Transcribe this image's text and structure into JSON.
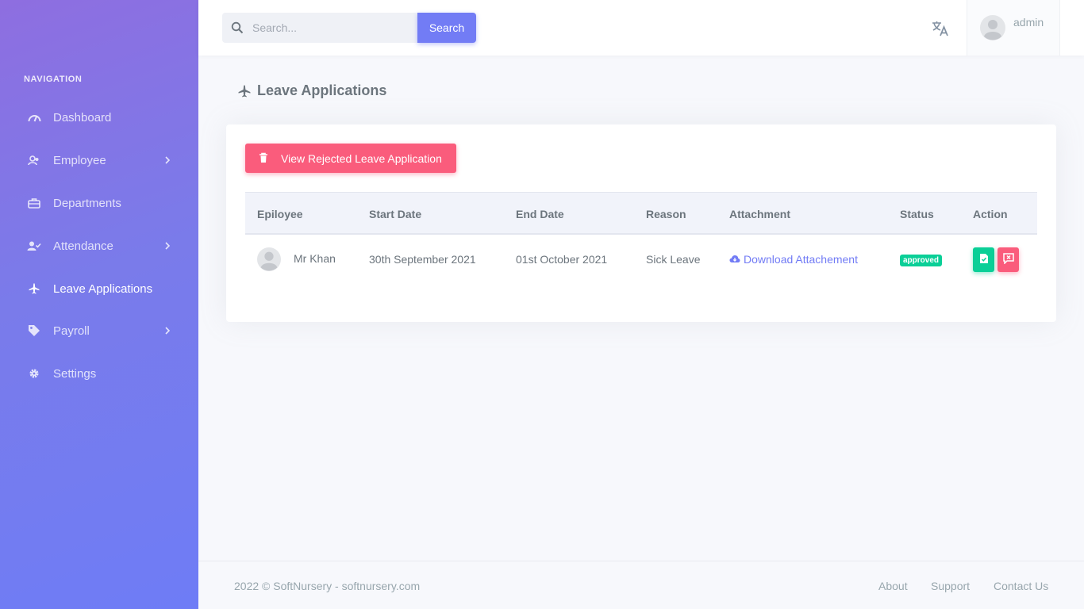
{
  "sidebar": {
    "heading": "NAVIGATION",
    "items": [
      {
        "label": "Dashboard",
        "icon": "gauge-icon"
      },
      {
        "label": "Employee",
        "icon": "users-icon"
      },
      {
        "label": "Departments",
        "icon": "briefcase-icon"
      },
      {
        "label": "Attendance",
        "icon": "user-check-icon"
      },
      {
        "label": "Leave Applications",
        "icon": "airplane-icon"
      },
      {
        "label": "Payroll",
        "icon": "tag-icon"
      },
      {
        "label": "Settings",
        "icon": "gear-icon"
      }
    ]
  },
  "topbar": {
    "search_placeholder": "Search...",
    "search_value": "",
    "search_button": "Search",
    "user_name": "admin"
  },
  "page": {
    "title": "Leave Applications",
    "rejected_button": "View Rejected Leave Application"
  },
  "table": {
    "headers": [
      "Epiloyee",
      "Start Date",
      "End Date",
      "Reason",
      "Attachment",
      "Status",
      "Action"
    ],
    "rows": [
      {
        "employee": "Mr Khan",
        "start_date": "30th September 2021",
        "end_date": "01st October 2021",
        "reason": "Sick Leave",
        "attachment": "Download Attachement",
        "status": "approved"
      }
    ]
  },
  "footer": {
    "copyright": "2022 © SoftNursery - softnursery.com",
    "links": [
      "About",
      "Support",
      "Contact Us"
    ]
  },
  "colors": {
    "primary": "#727cf5",
    "danger": "#fa5c7c",
    "success": "#0acf97"
  }
}
